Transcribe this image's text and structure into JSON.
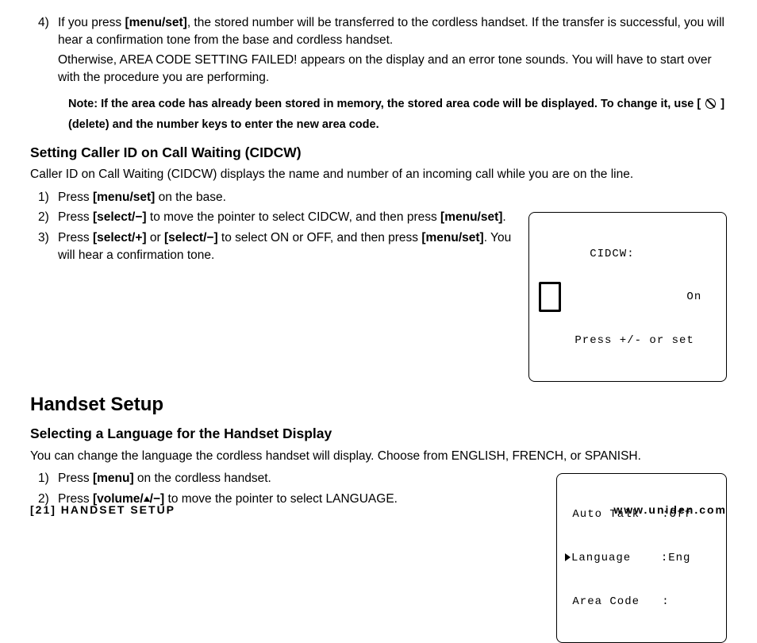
{
  "step4": {
    "num": "4)",
    "text_a": "If you press ",
    "bold_a": "[menu/set]",
    "text_b": ", the stored number will be transferred to the cordless handset. If the transfer is successful, you will hear a confirmation tone from the base and cordless handset.",
    "text_c": "Otherwise, AREA CODE SETTING FAILED! appears on the display and an error tone sounds. You will have to start over with the procedure you are performing."
  },
  "note": {
    "prefix": "Note:  ",
    "line_a": "If the area code has already been stored in memory, the stored area code will be displayed. To change it, use [ ",
    "line_b": " ] (delete) and the number keys to enter the new area code."
  },
  "cidcw": {
    "heading": "Setting Caller ID on Call Waiting (CIDCW)",
    "intro": "Caller ID on Call Waiting (CIDCW) displays the name and number of an incoming call while you are on the line.",
    "s1": {
      "num": "1)",
      "a": "Press ",
      "b": "[menu/set]",
      "c": " on the base."
    },
    "s2": {
      "num": "2)",
      "a": "Press ",
      "b": "[select/−]",
      "c": " to move the pointer to select CIDCW, and then press ",
      "d": "[menu/set]",
      "e": "."
    },
    "s3": {
      "num": "3)",
      "a": "Press ",
      "b": "[select/+]",
      "c": " or ",
      "d": "[select/−]",
      "e": "  to select ON or OFF, and then press ",
      "f": "[menu/set]",
      "g": ". You will hear a confirmation tone."
    }
  },
  "lcd_cidcw": {
    "line1": "   CIDCW:",
    "line2": "                On",
    "line3": " Press +/- or set"
  },
  "handset": {
    "h1": "Handset Setup",
    "h2": "Selecting a Language for the Handset Display",
    "intro": "You can change the language the cordless handset will display. Choose from ENGLISH, FRENCH, or SPANISH.",
    "s1": {
      "num": "1)",
      "a": "Press ",
      "b": "[menu]",
      "c": " on the cordless handset."
    },
    "s2": {
      "num": "2)",
      "a": "Press ",
      "b": "[volume/",
      "c": "/−]",
      "d": " to move the pointer to select LANGUAGE."
    }
  },
  "lcd_lang": {
    "line1": " Auto Talk   :Off",
    "line2": "Language    :Eng",
    "line3": " Area Code   :"
  },
  "footer": {
    "left": "[21] HANDSET SETUP",
    "right": "www.uniden.com"
  }
}
